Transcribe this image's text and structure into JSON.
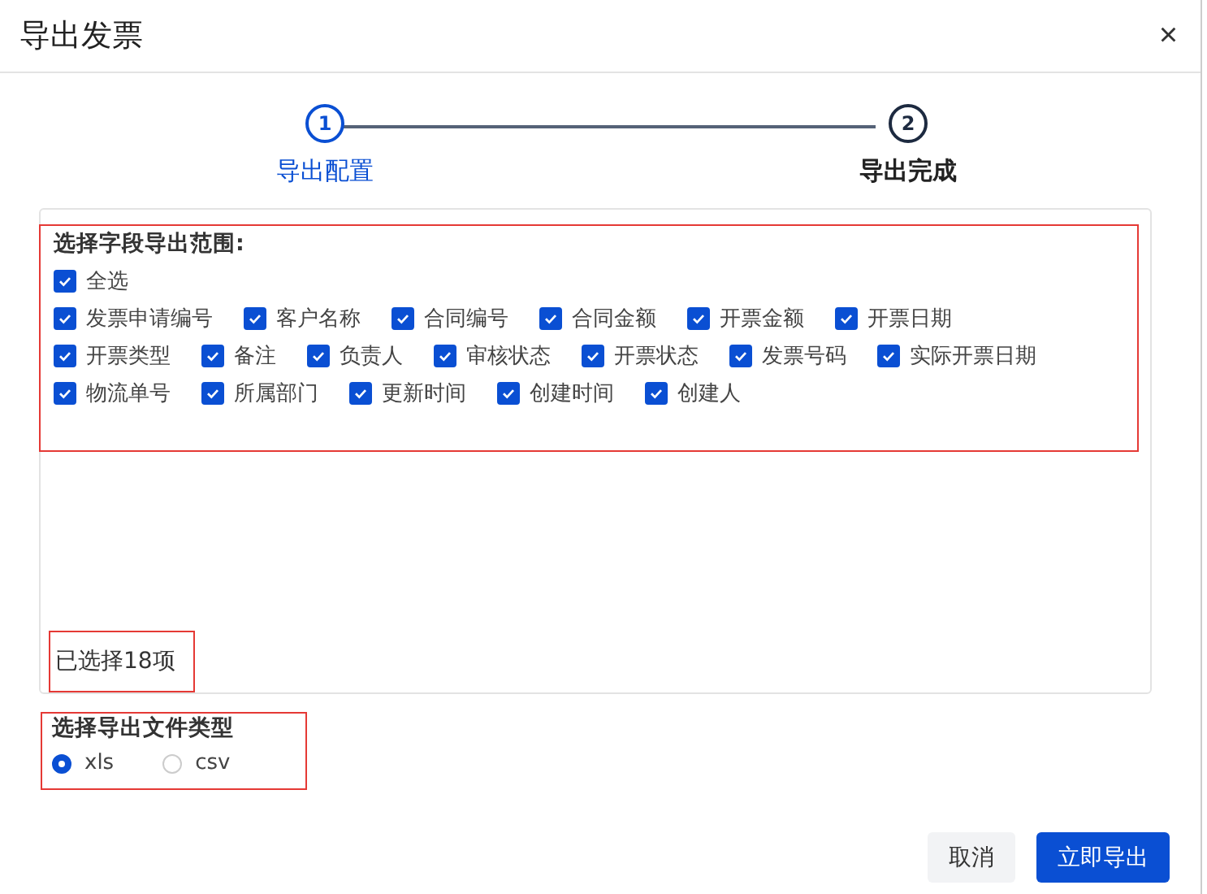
{
  "window": {
    "title": "导出发票",
    "close": "×"
  },
  "steps": [
    {
      "number": "1",
      "label": "导出配置",
      "selected": true
    },
    {
      "number": "2",
      "label": "导出完成",
      "selected": false
    }
  ],
  "fields": {
    "heading": "选择字段导出范围:",
    "select_all": {
      "label": "全选",
      "checked": true
    },
    "rows": [
      {
        "items": [
          {
            "label": "发票申请编号",
            "checked": true
          },
          {
            "label": "客户名称",
            "checked": true
          },
          {
            "label": "合同编号",
            "checked": true
          },
          {
            "label": "合同金额",
            "checked": true
          },
          {
            "label": "开票金额",
            "checked": true
          },
          {
            "label": "开票日期",
            "checked": true
          }
        ]
      },
      {
        "items": [
          {
            "label": "开票类型",
            "checked": true
          },
          {
            "label": "备注",
            "checked": true
          },
          {
            "label": "负责人",
            "checked": true
          },
          {
            "label": "审核状态",
            "checked": true
          },
          {
            "label": "开票状态",
            "checked": true
          },
          {
            "label": "发票号码",
            "checked": true
          },
          {
            "label": "实际开票日期",
            "checked": true
          }
        ]
      },
      {
        "items": [
          {
            "label": "物流单号",
            "checked": true
          },
          {
            "label": "所属部门",
            "checked": true
          },
          {
            "label": "更新时间",
            "checked": true
          },
          {
            "label": "创建时间",
            "checked": true
          },
          {
            "label": "创建人",
            "checked": true
          }
        ]
      }
    ],
    "count": "已选择18项"
  },
  "file_type": {
    "heading": "选择导出文件类型",
    "options": [
      {
        "label": "xls",
        "selected": true
      },
      {
        "label": "csv",
        "selected": false
      }
    ]
  },
  "buttons": [
    {
      "label": "取消",
      "kind": "secondary"
    },
    {
      "label": "立即导出",
      "kind": "primary"
    }
  ]
}
